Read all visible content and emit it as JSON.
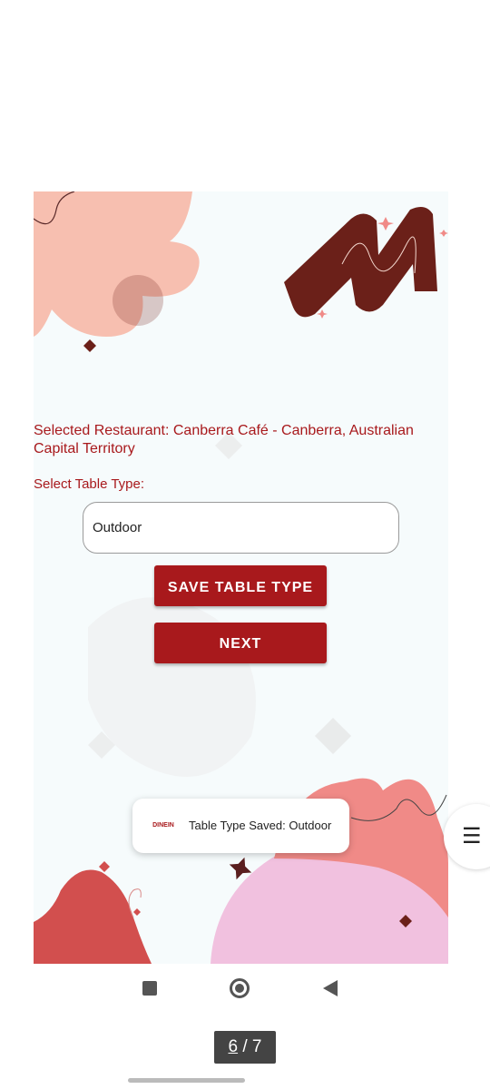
{
  "main": {
    "selected_restaurant": "Selected Restaurant: Canberra Café - Canberra, Australian Capital Territory",
    "select_label": "Select Table Type:",
    "table_type_value": "Outdoor",
    "save_button_label": "SAVE TABLE TYPE",
    "next_button_label": "NEXT"
  },
  "toast": {
    "logo_text": "DINEIN",
    "message": "Table Type Saved: Outdoor"
  },
  "menu_button": {
    "icon": "menu-icon",
    "glyph": "☰"
  },
  "nav": {
    "recents_icon": "recents-square-icon",
    "home_icon": "home-circle-icon",
    "back_icon": "back-triangle-icon"
  },
  "pager": {
    "current": "6",
    "separator": " / ",
    "total": "7"
  },
  "colors": {
    "accent": "#a8191c",
    "dark_brown": "#6b2019",
    "pink": "#f7bfb0",
    "coral": "#f08a87",
    "lilac": "#f1c1df",
    "background": "#f6fbfc"
  }
}
